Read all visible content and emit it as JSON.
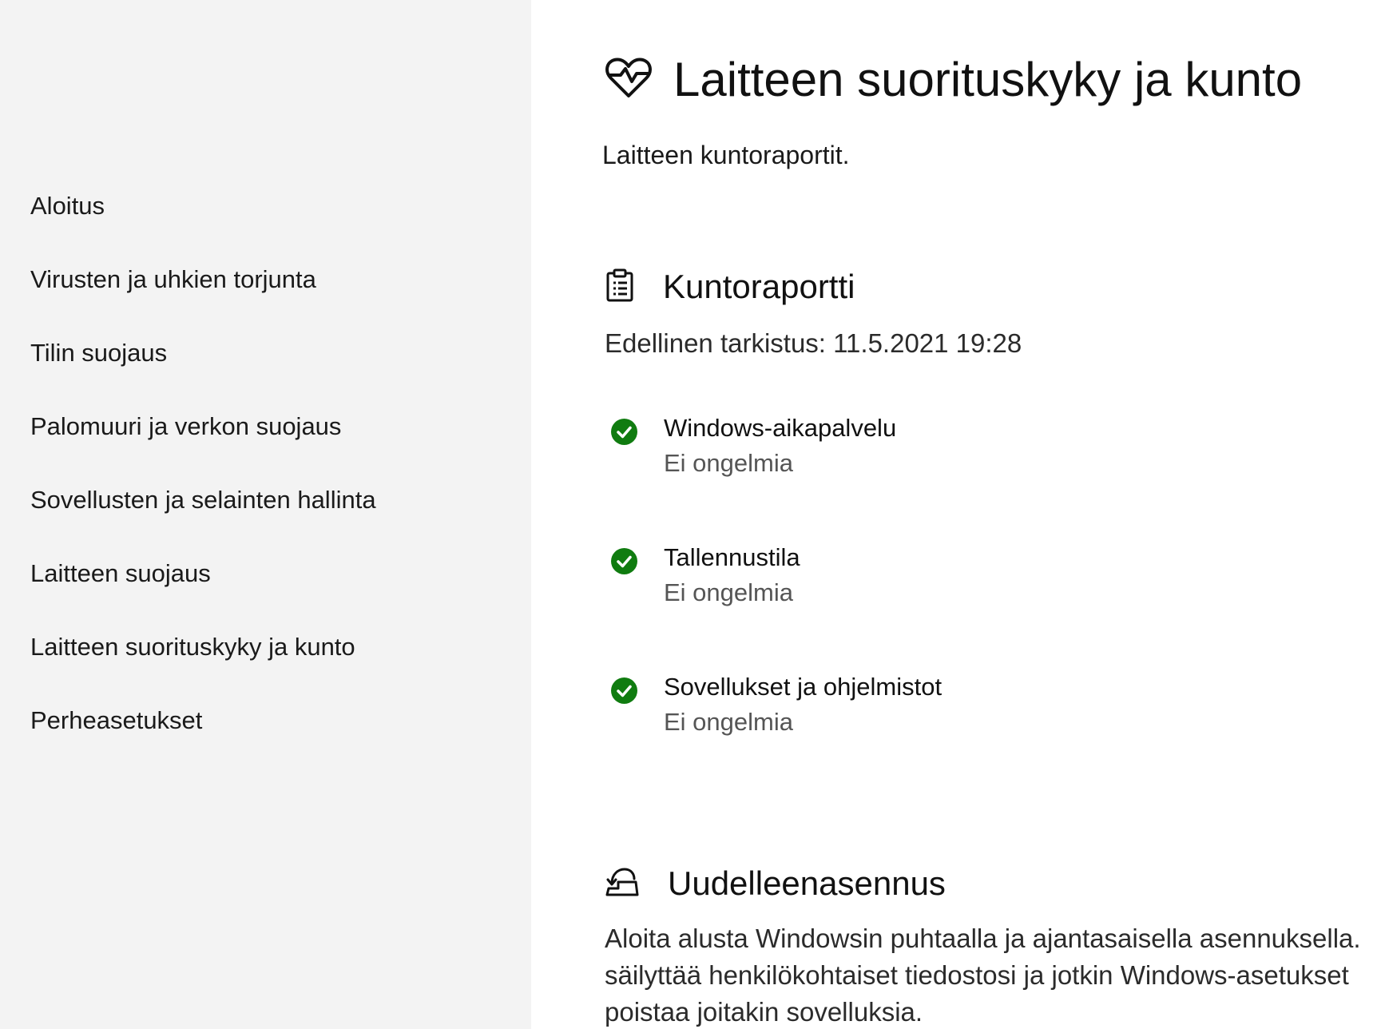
{
  "sidebar": {
    "items": [
      {
        "label": "Aloitus"
      },
      {
        "label": "Virusten ja uhkien torjunta"
      },
      {
        "label": "Tilin suojaus"
      },
      {
        "label": "Palomuuri ja verkon suojaus"
      },
      {
        "label": "Sovellusten ja selainten hallinta"
      },
      {
        "label": "Laitteen suojaus"
      },
      {
        "label": "Laitteen suorituskyky ja kunto"
      },
      {
        "label": "Perheasetukset"
      }
    ]
  },
  "main": {
    "title": "Laitteen suorituskyky ja kunto",
    "title_icon": "heart-pulse-icon",
    "subtitle": "Laitteen kuntoraportit.",
    "health_report": {
      "title": "Kuntoraportti",
      "icon": "clipboard-icon",
      "last_check": "Edellinen tarkistus: 11.5.2021 19:28",
      "items": [
        {
          "name": "Windows-aikapalvelu",
          "status": "Ei ongelmia"
        },
        {
          "name": "Tallennustila",
          "status": "Ei ongelmia"
        },
        {
          "name": "Sovellukset ja ohjelmistot",
          "status": "Ei ongelmia"
        }
      ]
    },
    "reinstall": {
      "title": "Uudelleenasennus",
      "icon": "reinstall-icon",
      "lines": [
        "Aloita alusta Windowsin puhtaalla ja ajantasaisella asennuksella.",
        "säilyttää henkilökohtaiset tiedostosi ja jotkin Windows-asetukset",
        "poistaa joitakin sovelluksia."
      ]
    }
  },
  "colors": {
    "sidebar_bg": "#f3f3f3",
    "check_green": "#107c10",
    "text": "#1a1a1a"
  }
}
